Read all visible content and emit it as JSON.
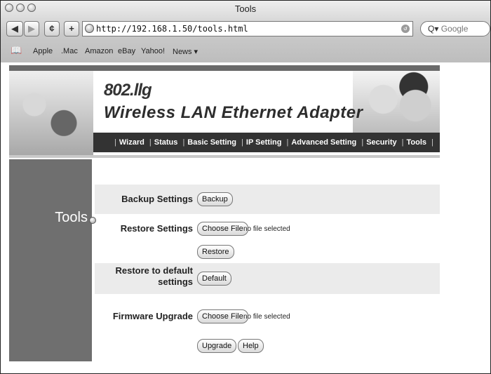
{
  "browser": {
    "title": "Tools",
    "url": "http://192.168.1.50/tools.html",
    "search_placeholder": "Google",
    "bookmarks": [
      "Apple",
      ".Mac",
      "Amazon",
      "eBay",
      "Yahoo!",
      "News ▾"
    ]
  },
  "banner": {
    "model": "802.llg",
    "product": "Wireless LAN Ethernet Adapter",
    "nav": [
      "Wizard",
      "Status",
      "Basic Setting",
      "IP Setting",
      "Advanced Setting",
      "Security",
      "Tools"
    ]
  },
  "sidebar": {
    "section": "Tools"
  },
  "tools": {
    "backup_label": "Backup Settings",
    "backup_button": "Backup",
    "restore_label": "Restore Settings",
    "choose_file_button": "Choose File",
    "no_file_text": "no file selected",
    "restore_button": "Restore",
    "default_label_line1": "Restore to default",
    "default_label_line2": "settings",
    "default_button": "Default",
    "firmware_label": "Firmware Upgrade",
    "firmware_choose_button": "Choose File",
    "firmware_no_file_text": "no file selected",
    "upgrade_button": "Upgrade",
    "help_button": "Help"
  }
}
